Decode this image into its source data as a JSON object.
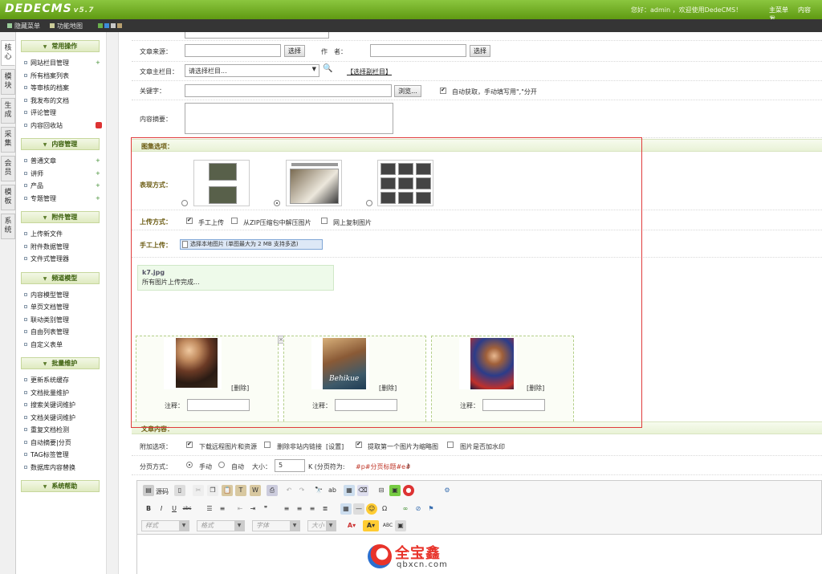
{
  "app": {
    "logo": "DEDECMS",
    "version": "v5.7",
    "welcome": "您好：admin ，欢迎使用DedeCMS！",
    "topnav": [
      "主菜单",
      "内容发"
    ],
    "toolbar_links": [
      "隐藏菜单",
      "功能地图"
    ]
  },
  "vtabs": [
    "核心",
    "模块",
    "生成",
    "采集",
    "会员",
    "模板",
    "系统"
  ],
  "menu": {
    "groups": [
      {
        "title": "常用操作",
        "items": [
          {
            "label": "网站栏目管理",
            "mark": "add"
          },
          {
            "label": "所有档案列表"
          },
          {
            "label": "等审核的档案"
          },
          {
            "label": "我发布的文档"
          },
          {
            "label": "评论管理"
          },
          {
            "label": "内容回收站",
            "mark": "del"
          }
        ]
      },
      {
        "title": "内容管理",
        "items": [
          {
            "label": "普通文章",
            "mark": "add"
          },
          {
            "label": "讲师",
            "mark": "add"
          },
          {
            "label": "产品",
            "mark": "add"
          },
          {
            "label": "专题管理",
            "mark": "add"
          }
        ]
      },
      {
        "title": "附件管理",
        "items": [
          {
            "label": "上传新文件"
          },
          {
            "label": "附件数据管理"
          },
          {
            "label": "文件式管理器"
          }
        ]
      },
      {
        "title": "频道模型",
        "items": [
          {
            "label": "内容模型管理"
          },
          {
            "label": "单页文档管理"
          },
          {
            "label": "联动类别管理"
          },
          {
            "label": "自由列表管理"
          },
          {
            "label": "自定义表单"
          }
        ]
      },
      {
        "title": "批量维护",
        "items": [
          {
            "label": "更新系统缓存"
          },
          {
            "label": "文档批量维护"
          },
          {
            "label": "搜索关键词维护"
          },
          {
            "label": "文档关键词维护"
          },
          {
            "label": "重复文档检测"
          },
          {
            "label": "自动摘要|分页"
          },
          {
            "label": "TAG标签管理"
          },
          {
            "label": "数据库内容替换"
          }
        ]
      },
      {
        "title": "系统帮助",
        "items": []
      }
    ]
  },
  "form": {
    "source_label": "文章来源：",
    "select_btn": "选择",
    "author_label": "作　者：",
    "main_column_label": "文章主栏目：",
    "column_select_value": "请选择栏目...",
    "pick_column_link": "【选择副栏目】",
    "keyword_label": "关键字：",
    "browse_btn": "浏览...",
    "auto_keyword_label": "自动获取，手动填写用\",\"分开",
    "summary_label": "内容摘要："
  },
  "gallery": {
    "section_title": "图集选项：",
    "display_label": "表现方式：",
    "upload_label": "上传方式：",
    "upload_options": [
      {
        "label": "手工上传",
        "checked": true
      },
      {
        "label": "从ZIP压缩包中解压图片",
        "checked": false
      },
      {
        "label": "网上复制图片",
        "checked": false
      }
    ],
    "manual_upload_label": "手工上传：",
    "upload_button": "选择本地图片 (单图最大为 2 MB  支持多选)",
    "upload_status_file": "k7.jpg",
    "upload_status_msg": "所有图片上传完成...",
    "delete_label": "[删除]",
    "note_label": "注释：",
    "posters": [
      "Behikue"
    ]
  },
  "content": {
    "section_title": "文章内容：",
    "extra_label": "附加选项：",
    "extra_options": [
      {
        "label": "下载远程图片和资源",
        "checked": true
      },
      {
        "label": "删除非站内链接",
        "checked": false
      },
      {
        "label": "[设置]"
      },
      {
        "label": "提取第一个图片为缩略图",
        "checked": true
      },
      {
        "label": "图片是否加水印",
        "checked": false
      }
    ],
    "paging_label": "分页方式：",
    "paging_manual": "手动",
    "paging_auto": "自动",
    "size_label": "大小：",
    "size_value": "5",
    "paging_hint": "K (分页符为:",
    "paging_token": "#p#分页标题#e#",
    "paging_close": ")"
  },
  "editor": {
    "source_btn": "源码",
    "style_sel": "样式",
    "format_sel": "格式",
    "font_sel": "字体",
    "size_sel": "大小"
  },
  "watermark": {
    "name": "全宝鑫",
    "domain": "qbxcn.com"
  }
}
